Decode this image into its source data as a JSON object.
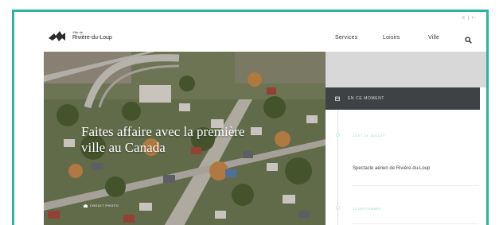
{
  "header": {
    "logo_small": "Ville de",
    "logo_main": "Rivière-du-Loup",
    "utility": "≡ | ⊢"
  },
  "nav": {
    "items": [
      {
        "label": "Services"
      },
      {
        "label": "Loisirs"
      },
      {
        "label": "Ville"
      }
    ]
  },
  "hero": {
    "title": "Faites affaire avec la première ville au Canada",
    "caption": "CREDIT PHOTO"
  },
  "events": {
    "header": "EN CE MOMENT",
    "items": [
      {
        "date": "23 ET 24 JUILLET",
        "title": "Spectacle aérien de Rivière-du-Loup"
      },
      {
        "date": "12 SEPTEMBRE",
        "title": ""
      }
    ]
  },
  "colors": {
    "accent": "#2bb3a4",
    "dark_bar": "#3f4244",
    "date_text": "#8fd6cc"
  },
  "icons": {
    "search": "magnifier-icon",
    "calendar": "calendar-icon",
    "logo": "wolf-logo-icon"
  }
}
